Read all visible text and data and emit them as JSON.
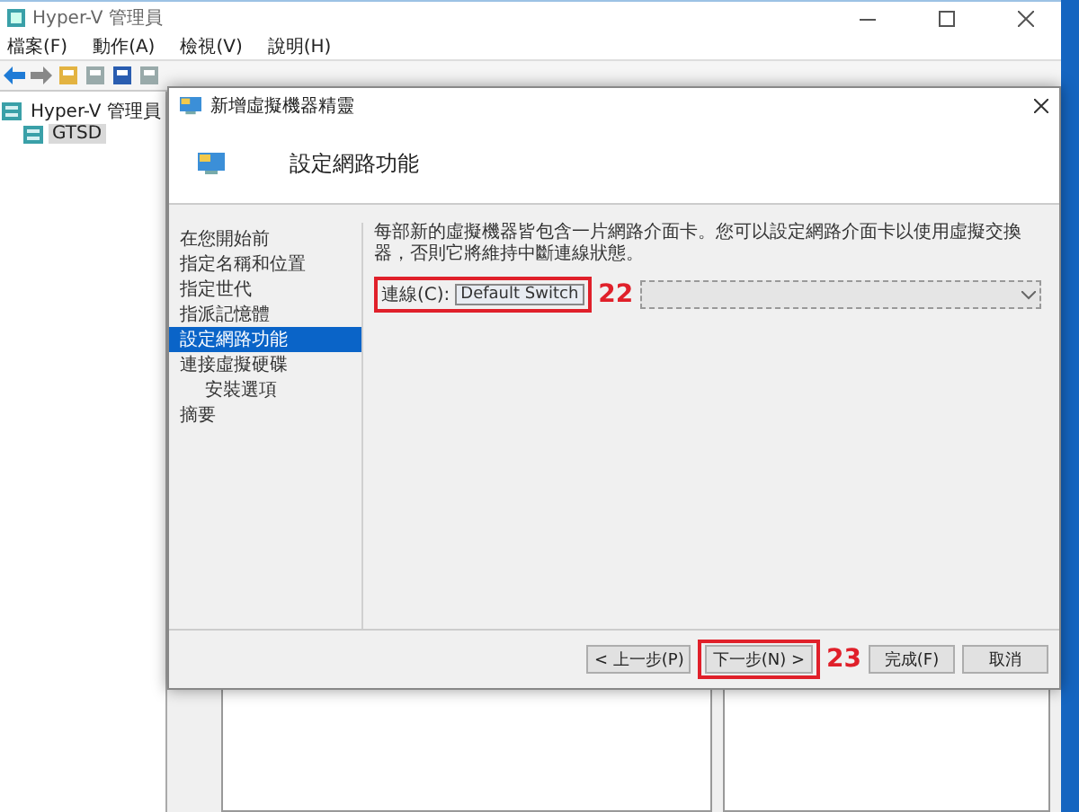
{
  "window": {
    "title": "Hyper-V 管理員"
  },
  "menu": [
    "檔案(F)",
    "動作(A)",
    "檢視(V)",
    "說明(H)"
  ],
  "tree": [
    {
      "label": "Hyper-V 管理員",
      "selected": false,
      "children": [
        {
          "label": "GTSD",
          "selected": true
        }
      ]
    }
  ],
  "dialog": {
    "title": "新增虛擬機器精靈",
    "heading": "設定網路功能",
    "steps": [
      {
        "label": "在您開始前",
        "selected": false
      },
      {
        "label": "指定名稱和位置",
        "selected": false
      },
      {
        "label": "指定世代",
        "selected": false
      },
      {
        "label": "指派記憶體",
        "selected": false
      },
      {
        "label": "設定網路功能",
        "selected": true
      },
      {
        "label": "連接虛擬硬碟",
        "selected": false,
        "children": [
          {
            "label": "安裝選項",
            "selected": false
          }
        ]
      },
      {
        "label": "摘要",
        "selected": false
      }
    ],
    "description": "每部新的虛擬機器皆包含一片網路介面卡。您可以設定網路介面卡以使用虛擬交換器，否則它將維持中斷連線狀態。",
    "connection": {
      "label": "連線(C):",
      "value": "Default Switch",
      "annotation": "22"
    },
    "buttons": [
      {
        "label": "< 上一步(P)"
      },
      {
        "label": "下一步(N) >",
        "annotation": "23"
      },
      {
        "label": "完成(F)"
      },
      {
        "label": "取消"
      }
    ]
  }
}
